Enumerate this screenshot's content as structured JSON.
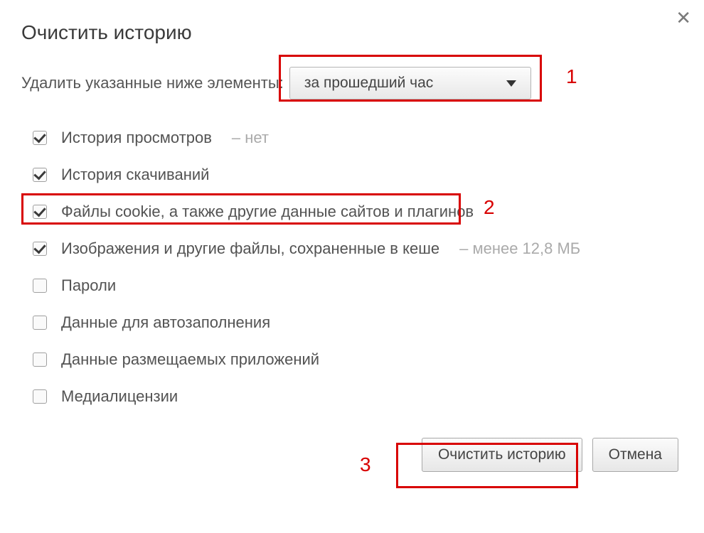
{
  "title": "Очистить историю",
  "subtitle": "Удалить указанные ниже элементы:",
  "dropdown": {
    "selected": "за прошедший час"
  },
  "options": [
    {
      "label": "История просмотров",
      "suffix": "–  нет",
      "checked": true
    },
    {
      "label": "История скачиваний",
      "suffix": "",
      "checked": true
    },
    {
      "label": "Файлы cookie, а также другие данные сайтов и плагинов",
      "suffix": "",
      "checked": true
    },
    {
      "label": "Изображения и другие файлы, сохраненные в кеше",
      "suffix": "–  менее 12,8 МБ",
      "checked": true
    },
    {
      "label": "Пароли",
      "suffix": "",
      "checked": false
    },
    {
      "label": "Данные для автозаполнения",
      "suffix": "",
      "checked": false
    },
    {
      "label": "Данные размещаемых приложений",
      "suffix": "",
      "checked": false
    },
    {
      "label": "Медиалицензии",
      "suffix": "",
      "checked": false
    }
  ],
  "buttons": {
    "clear": "Очистить историю",
    "cancel": "Отмена"
  },
  "annotations": {
    "n1": "1",
    "n2": "2",
    "n3": "3"
  }
}
